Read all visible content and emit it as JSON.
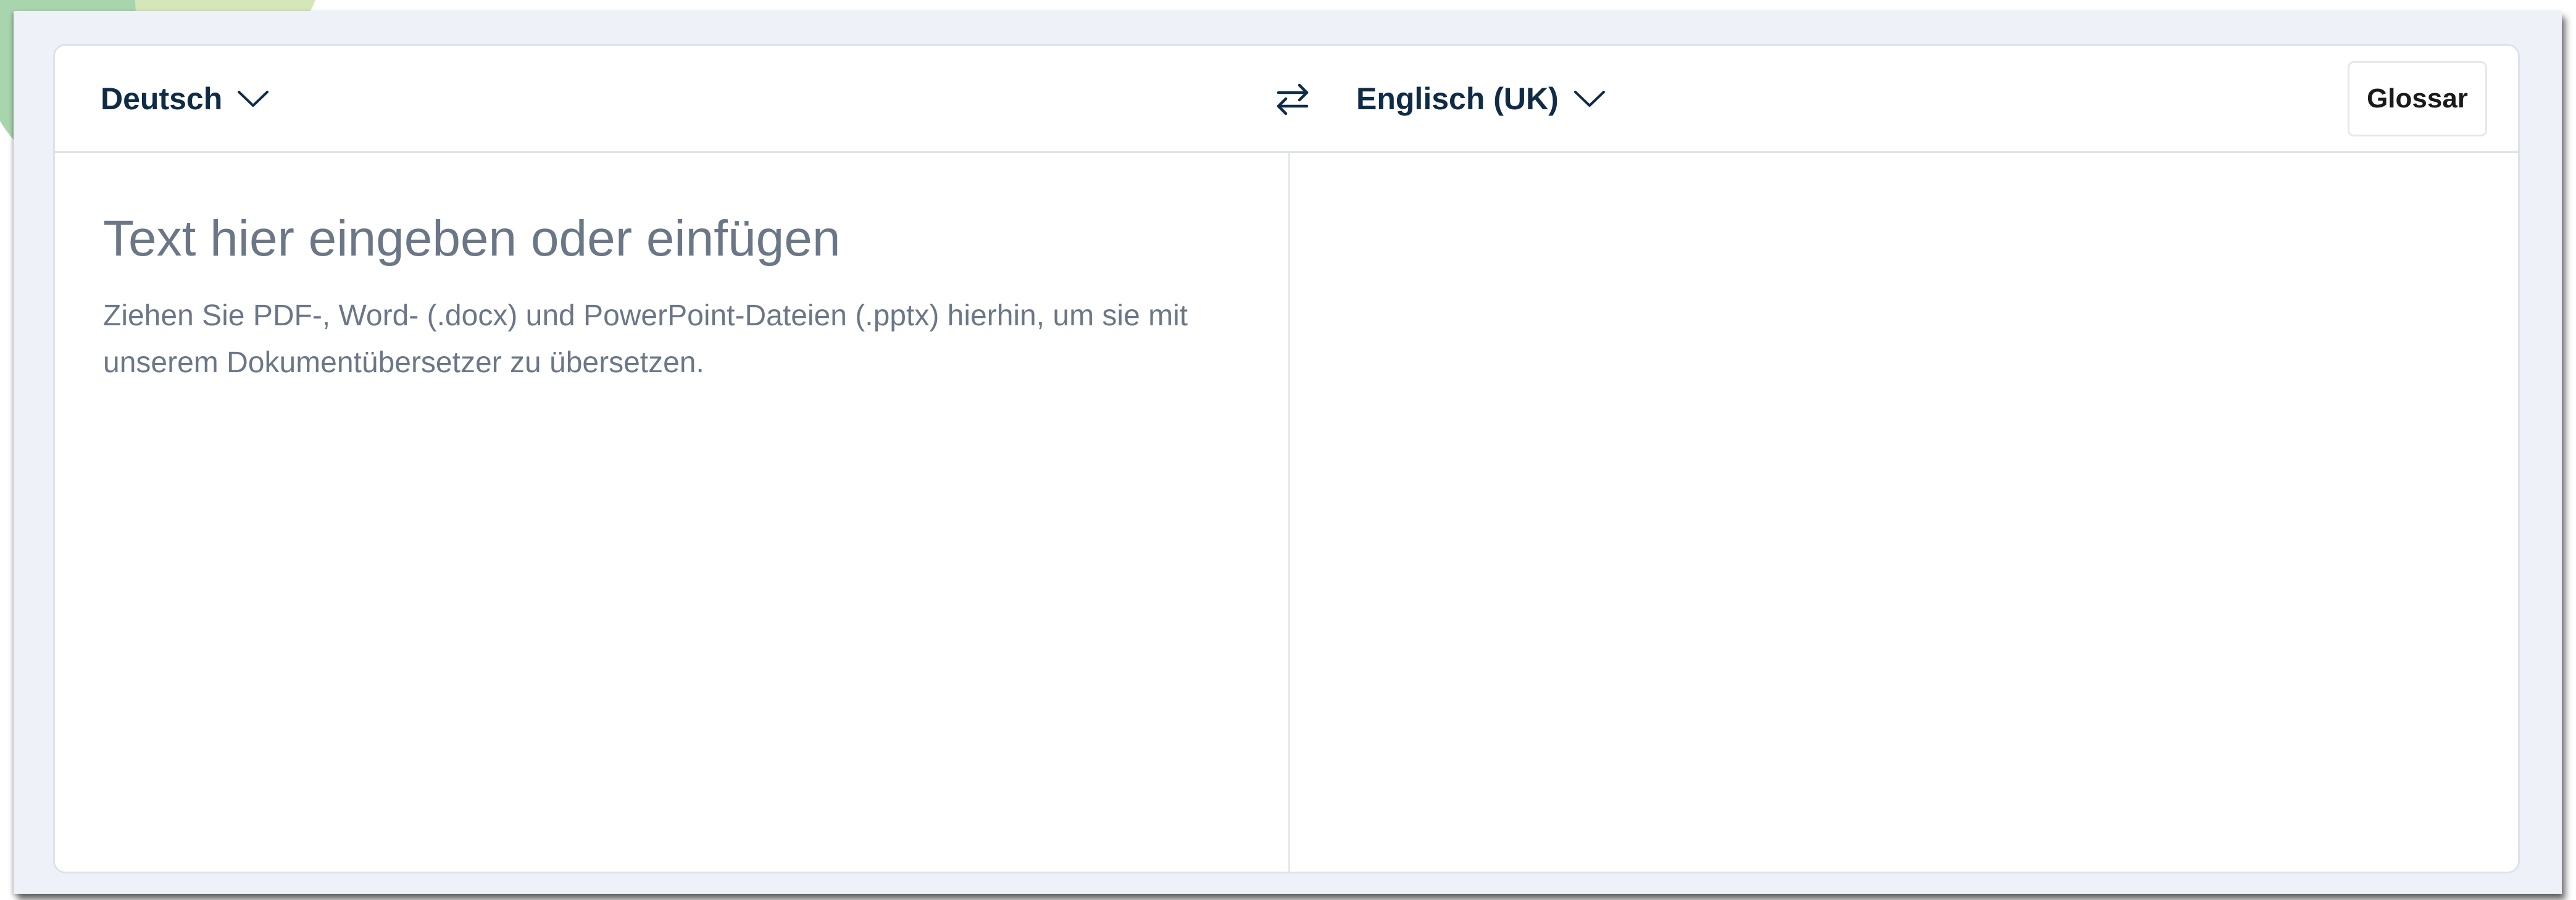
{
  "translator": {
    "source_language": "Deutsch",
    "target_language": "Englisch (UK)",
    "glossary_button": "Glossar",
    "source_placeholder": "Text hier eingeben oder einfügen",
    "drop_hint": "Ziehen Sie PDF-, Word- (.docx) und PowerPoint-Dateien (.pptx) hierhin, um sie mit unserem Dokumentübersetzer zu übersetzen.",
    "target_text": ""
  },
  "icons": {
    "source_dropdown": "chevron-down-icon",
    "target_dropdown": "chevron-down-icon",
    "swap": "swap-arrows-icon"
  },
  "colors": {
    "frame_background": "#eef2f8",
    "text_primary": "#0f2b46",
    "text_placeholder": "#6b7787",
    "border": "#dde2ea"
  }
}
